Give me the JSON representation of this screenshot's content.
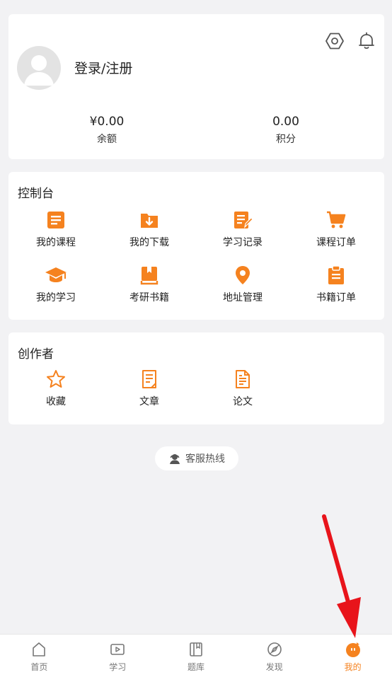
{
  "theme": {
    "accent": "#f5821f",
    "annotation": "#e8141b"
  },
  "header": {
    "login_label": "登录/注册",
    "icons": [
      "settings-icon",
      "bell-icon"
    ]
  },
  "stats": {
    "balance_value": "¥0.00",
    "balance_label": "余额",
    "points_value": "0.00",
    "points_label": "积分"
  },
  "console": {
    "title": "控制台",
    "items": [
      {
        "label": "我的课程",
        "icon": "course-icon"
      },
      {
        "label": "我的下载",
        "icon": "download-icon"
      },
      {
        "label": "学习记录",
        "icon": "study-record-icon"
      },
      {
        "label": "课程订单",
        "icon": "cart-icon"
      },
      {
        "label": "我的学习",
        "icon": "graduation-cap-icon"
      },
      {
        "label": "考研书籍",
        "icon": "book-icon"
      },
      {
        "label": "地址管理",
        "icon": "location-pin-icon"
      },
      {
        "label": "书籍订单",
        "icon": "clipboard-icon"
      }
    ]
  },
  "creator": {
    "title": "创作者",
    "items": [
      {
        "label": "收藏",
        "icon": "star-icon"
      },
      {
        "label": "文章",
        "icon": "article-icon"
      },
      {
        "label": "论文",
        "icon": "paper-icon"
      }
    ]
  },
  "hotline": {
    "label": "客服热线",
    "icon": "headset-icon"
  },
  "bottom_nav": {
    "items": [
      {
        "label": "首页",
        "icon": "home-icon"
      },
      {
        "label": "学习",
        "icon": "video-icon"
      },
      {
        "label": "题库",
        "icon": "question-bank-icon"
      },
      {
        "label": "发现",
        "icon": "discover-icon"
      },
      {
        "label": "我的",
        "icon": "profile-icon",
        "active": true
      }
    ]
  }
}
